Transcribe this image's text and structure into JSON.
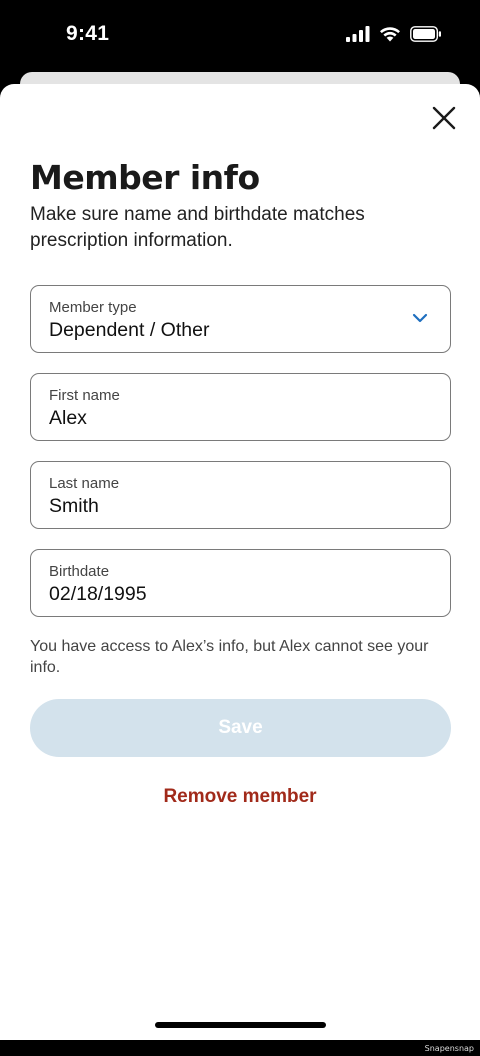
{
  "status_bar": {
    "time": "9:41",
    "icons": [
      "cellular-signal-icon",
      "wifi-icon",
      "battery-icon"
    ]
  },
  "sheet": {
    "close_icon": "close-icon",
    "title": "Member info",
    "subtitle": "Make sure name and birthdate matches prescription information.",
    "fields": {
      "member_type": {
        "label": "Member type",
        "value": "Dependent / Other"
      },
      "first_name": {
        "label": "First name",
        "value": "Alex"
      },
      "last_name": {
        "label": "Last name",
        "value": "Smith"
      },
      "birthdate": {
        "label": "Birthdate",
        "value": "02/18/1995"
      }
    },
    "note": "You have access to Alex’s info, but Alex cannot see your info.",
    "save_label": "Save",
    "remove_label": "Remove member"
  },
  "watermark": "Snapensnap",
  "colors": {
    "accent_blue": "#1f6fbf",
    "save_disabled_bg": "#d3e2ec",
    "remove_red": "#a12a1a"
  }
}
